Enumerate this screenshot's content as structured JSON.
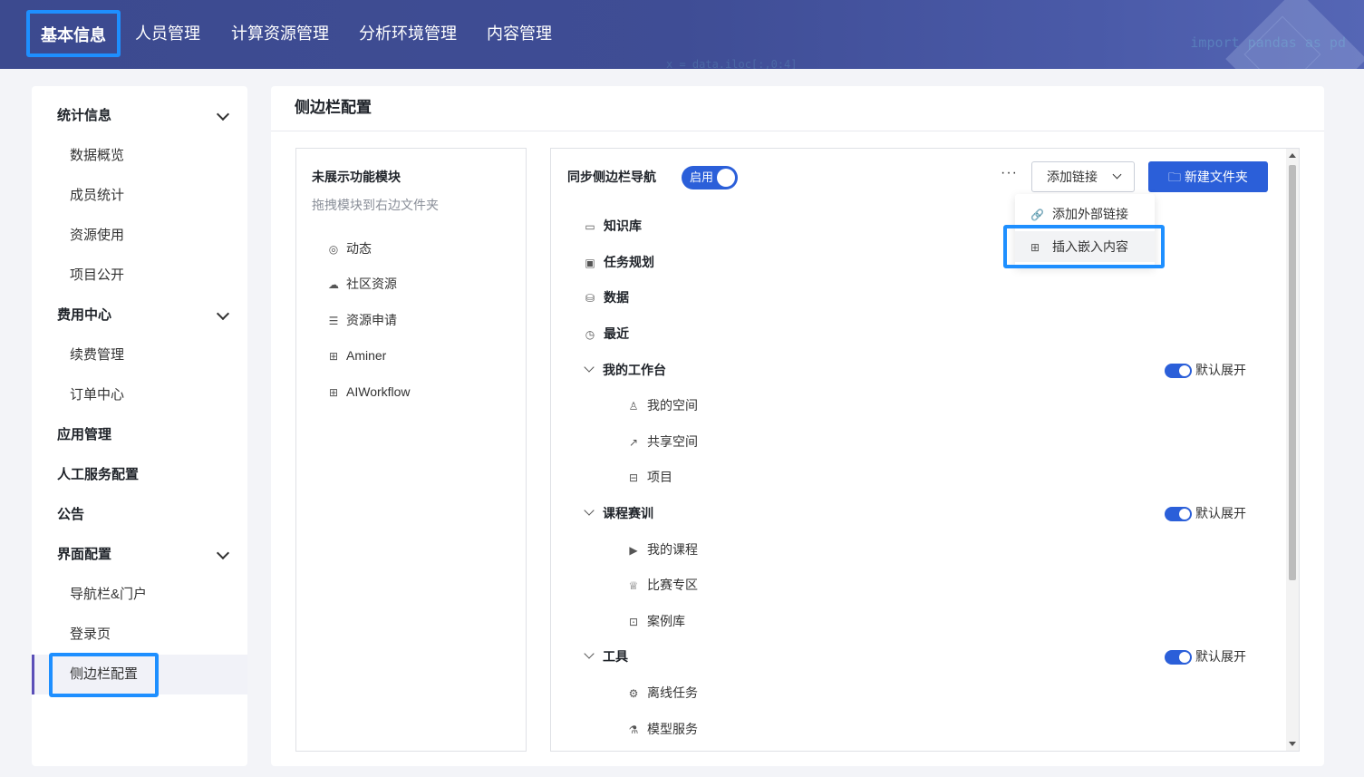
{
  "topnav": {
    "items": [
      "基本信息",
      "人员管理",
      "计算资源管理",
      "分析环境管理",
      "内容管理"
    ],
    "deco_code": "import pandas as pd",
    "deco_code2": "x = data.iloc[:,0:4]"
  },
  "sidebar": {
    "groups": [
      {
        "label": "统计信息",
        "children": [
          "数据概览",
          "成员统计",
          "资源使用",
          "项目公开"
        ]
      },
      {
        "label": "费用中心",
        "children": [
          "续费管理",
          "订单中心"
        ]
      },
      {
        "label": "应用管理"
      },
      {
        "label": "人工服务配置"
      },
      {
        "label": "公告"
      },
      {
        "label": "界面配置",
        "children": [
          "导航栏&门户",
          "登录页",
          "侧边栏配置"
        ]
      }
    ]
  },
  "main": {
    "title": "侧边栏配置",
    "left_pane": {
      "title": "未展示功能模块",
      "subtitle": "拖拽模块到右边文件夹",
      "items": [
        {
          "icon": "dynamic-icon",
          "label": "动态"
        },
        {
          "icon": "cloud-icon",
          "label": "社区资源"
        },
        {
          "icon": "server-icon",
          "label": "资源申请"
        },
        {
          "icon": "grid-icon",
          "label": "Aminer"
        },
        {
          "icon": "grid-icon",
          "label": "AIWorkflow"
        }
      ]
    },
    "right_pane": {
      "sync_label": "同步侧边栏导航",
      "sync_toggle": "启用",
      "more": "···",
      "add_link": "添加链接",
      "new_folder": "新建文件夹",
      "dropdown": [
        "添加外部链接",
        "插入嵌入内容"
      ],
      "roots": [
        "知识库",
        "任务规划",
        "数据",
        "最近"
      ],
      "groups": [
        {
          "label": "我的工作台",
          "default_expand": "默认展开",
          "children": [
            "我的空间",
            "共享空间",
            "项目"
          ]
        },
        {
          "label": "课程赛训",
          "default_expand": "默认展开",
          "children": [
            "我的课程",
            "比赛专区",
            "案例库"
          ]
        },
        {
          "label": "工具",
          "default_expand": "默认展开",
          "children": [
            "离线任务",
            "模型服务"
          ]
        }
      ]
    }
  },
  "colors": {
    "primary": "#2b5fd9",
    "highlight": "#1e8fff",
    "nav_bg": "#3f4d95"
  }
}
